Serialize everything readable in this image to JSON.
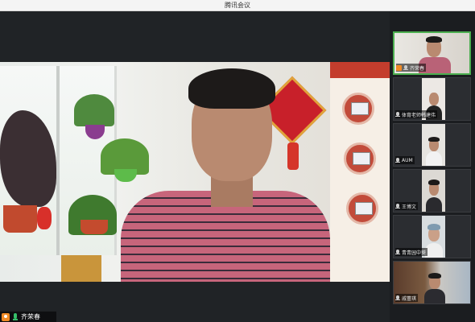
{
  "window": {
    "title": "腾讯会议"
  },
  "main_video": {
    "speaker_name": "齐荣春"
  },
  "participants": [
    {
      "name": "齐荣春",
      "active": true,
      "mic": "on"
    },
    {
      "name": "体育老师韩建伟",
      "active": false,
      "mic": "off"
    },
    {
      "name": "AUM",
      "active": false,
      "mic": "off"
    },
    {
      "name": "王博文",
      "active": false,
      "mic": "off"
    },
    {
      "name": "青青园中葵",
      "active": false,
      "mic": "off"
    },
    {
      "name": "戚蕾琪",
      "active": false,
      "mic": "off"
    }
  ],
  "colors": {
    "active_border": "#4caf50",
    "host_badge": "#f08a24",
    "mic_on": "#36c06a"
  }
}
